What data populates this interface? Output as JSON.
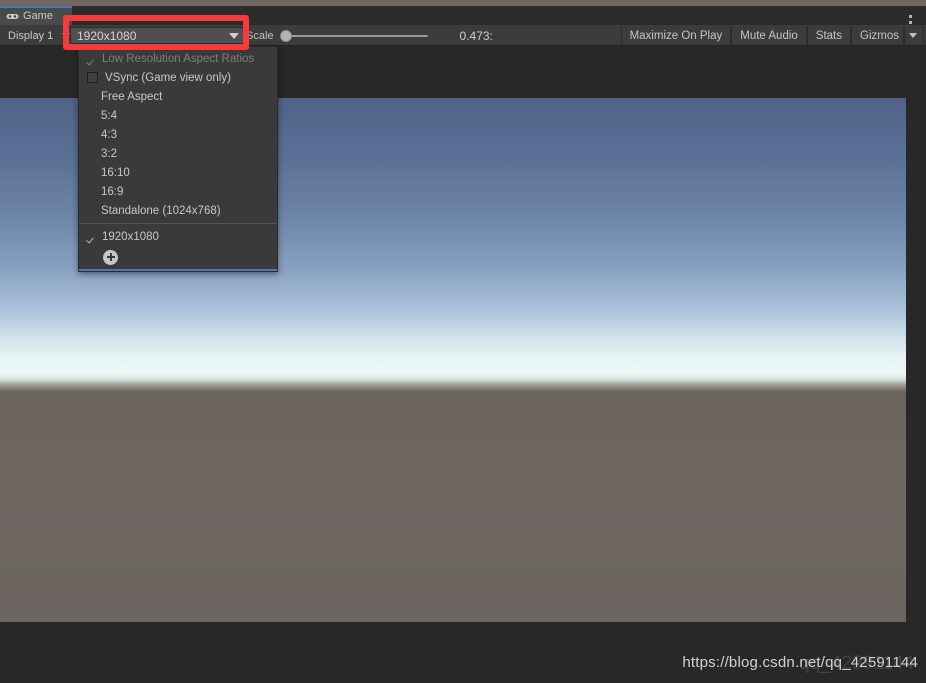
{
  "window": {
    "kebab_icon": "kebab-menu-icon"
  },
  "tab": {
    "label": "Game",
    "icon": "gamepad-icon"
  },
  "toolbar": {
    "display_label": "Display 1",
    "resolution_label": "1920x1080",
    "scale_label": "Scale",
    "scale_value": "0.473:",
    "scale_slider_position": 0,
    "maximize_on_play_label": "Maximize On Play",
    "mute_audio_label": "Mute Audio",
    "stats_label": "Stats",
    "gizmos_label": "Gizmos",
    "gizmos_arrow_icon": "chevron-down-icon",
    "resolution_arrow_icon": "chevron-down-icon",
    "display_arrow_icon": "chevron-down-icon"
  },
  "resolution_menu": {
    "low_res_label": "Low Resolution Aspect Ratios",
    "low_res_checked": true,
    "vsync_label": "VSync (Game view only)",
    "vsync_checked": false,
    "aspect_items": [
      {
        "label": "Free Aspect"
      },
      {
        "label": "5:4"
      },
      {
        "label": "4:3"
      },
      {
        "label": "3:2"
      },
      {
        "label": "16:10"
      },
      {
        "label": "16:9"
      },
      {
        "label": "Standalone (1024x768)"
      }
    ],
    "selected_item": {
      "label": "1920x1080",
      "checked": true
    },
    "add_icon": "plus-circle-icon"
  },
  "annotation": {
    "highlight_color": "#f33b3b"
  },
  "game_view": {
    "sky_top_color": "#4e6187",
    "sky_horizon_color": "#f2fbf7",
    "ground_color": "#6c6560"
  },
  "watermark": {
    "text": "https://blog.csdn.net/qq_42591144",
    "ghost_text": "qq_42591144"
  }
}
